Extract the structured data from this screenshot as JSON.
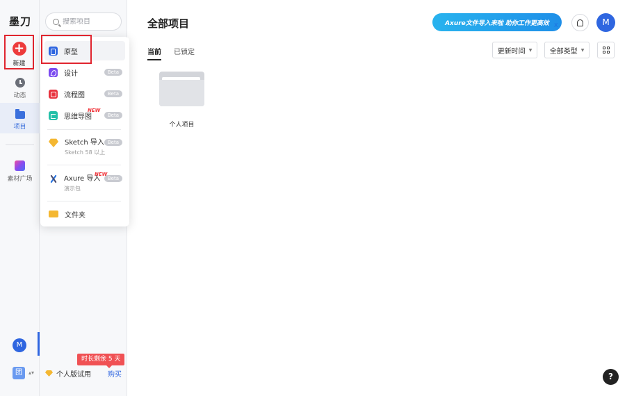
{
  "rail": {
    "logo": "墨刀",
    "new_label": "新建",
    "items": [
      {
        "label": "动态"
      },
      {
        "label": "项目"
      },
      {
        "label": "素材广场"
      }
    ],
    "avatar_letter": "M",
    "team_icon": "团"
  },
  "sidebar": {
    "search_placeholder": "搜索项目",
    "trial_badge": "时长剩余 5 天",
    "trial_label": "个人版试用",
    "buy_label": "购买"
  },
  "menu": {
    "items": [
      {
        "label": "原型",
        "icon": "prototype-icon"
      },
      {
        "label": "设计",
        "icon": "design-icon",
        "badge": "Beta"
      },
      {
        "label": "流程图",
        "icon": "flowchart-icon",
        "badge": "Beta"
      },
      {
        "label": "思维导图",
        "icon": "mindmap-icon",
        "badge": "Beta",
        "tag": "NEW"
      },
      {
        "label": "Sketch 导入",
        "sub": "Sketch 58 以上",
        "icon": "sketch-icon",
        "badge": "Beta"
      },
      {
        "label": "Axure 导入",
        "sub": "演示包",
        "icon": "axure-icon",
        "badge": "Beta",
        "tag": "NEW"
      },
      {
        "label": "文件夹",
        "icon": "folder-icon"
      }
    ]
  },
  "main": {
    "title": "全部项目",
    "banner": "Axure文件导入来啦  助你工作更高效",
    "banner_close": "X",
    "avatar_letter": "M",
    "tabs": [
      {
        "label": "当前",
        "active": true
      },
      {
        "label": "已锁定",
        "active": false
      }
    ],
    "sort_label": "更新时间",
    "type_label": "全部类型",
    "folder_label": "个人项目",
    "help": "?"
  },
  "colors": {
    "accent": "#2f66e0",
    "highlight": "#e0242e",
    "new_button": "#ed3b3b",
    "trial": "#f05154"
  }
}
